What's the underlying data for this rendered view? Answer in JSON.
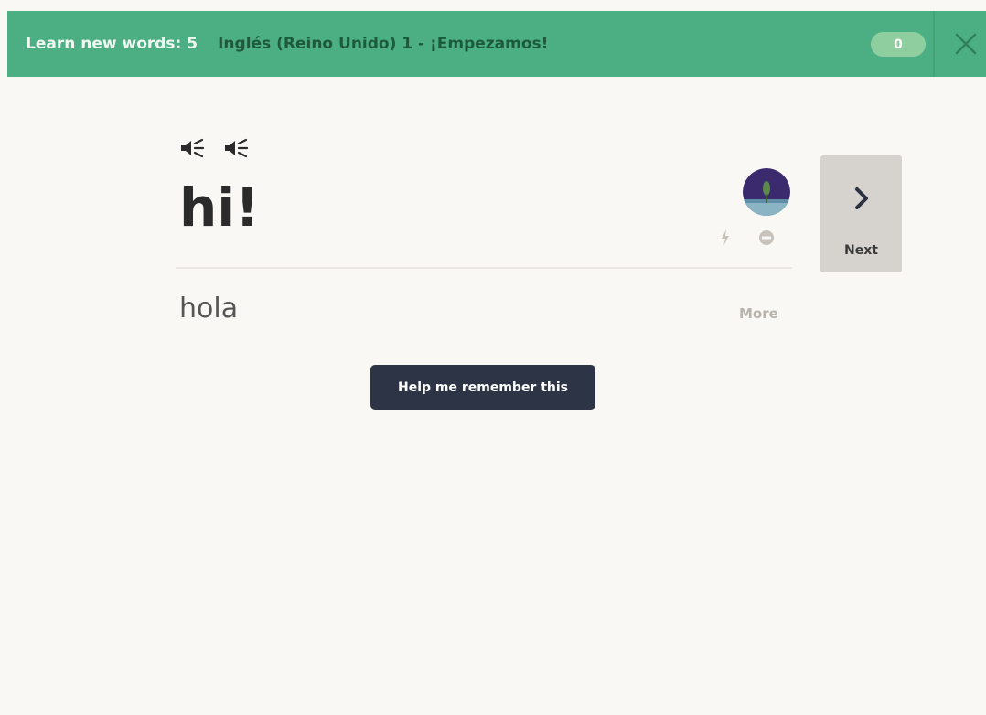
{
  "header": {
    "session_label": "Learn new words: 5",
    "course_label": "Inglés (Reino Unido) 1 - ¡Empezamos!",
    "score": "0",
    "close_icon": "close-icon"
  },
  "card": {
    "audio_icons": [
      "speaker-icon",
      "speaker-icon"
    ],
    "word": "hi!",
    "translation": "hola",
    "more_label": "More",
    "avatar_icon": "mem-avatar-icon",
    "difficult_icon": "lightning-icon",
    "ignore_icon": "ignore-icon"
  },
  "next": {
    "label": "Next",
    "icon": "chevron-right-icon"
  },
  "help": {
    "label": "Help me remember this"
  },
  "colors": {
    "topbar": "#4caf84",
    "course_text": "#1d5a3b",
    "help_button": "#2c3446",
    "background": "#faf8f4"
  }
}
